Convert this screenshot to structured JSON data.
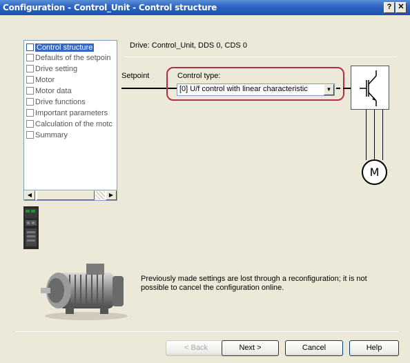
{
  "window": {
    "title": "Configuration - Control_Unit - Control structure",
    "help_button": "?",
    "close_button": "✕"
  },
  "steps": [
    {
      "label": "Control structure",
      "selected": true
    },
    {
      "label": "Defaults of the setpoin",
      "selected": false
    },
    {
      "label": "Drive setting",
      "selected": false
    },
    {
      "label": "Motor",
      "selected": false
    },
    {
      "label": "Motor data",
      "selected": false
    },
    {
      "label": "Drive functions",
      "selected": false
    },
    {
      "label": "Important parameters",
      "selected": false
    },
    {
      "label": "Calculation of the motc",
      "selected": false
    },
    {
      "label": "Summary",
      "selected": false
    }
  ],
  "main": {
    "drive_info": "Drive: Control_Unit, DDS 0, CDS 0",
    "setpoint_label": "Setpoint",
    "control_type_label": "Control type:",
    "control_type_value": "[0] U/f control with linear characteristic",
    "motor_symbol": "M",
    "note": "Previously made settings are lost through a reconfiguration; it is not possible to cancel the configuration online."
  },
  "buttons": {
    "back": "< Back",
    "next": "Next >",
    "cancel": "Cancel",
    "help": "Help"
  },
  "colors": {
    "titlebar": "#2d64c4",
    "highlight": "#b0304a",
    "selection": "#3168c8"
  }
}
